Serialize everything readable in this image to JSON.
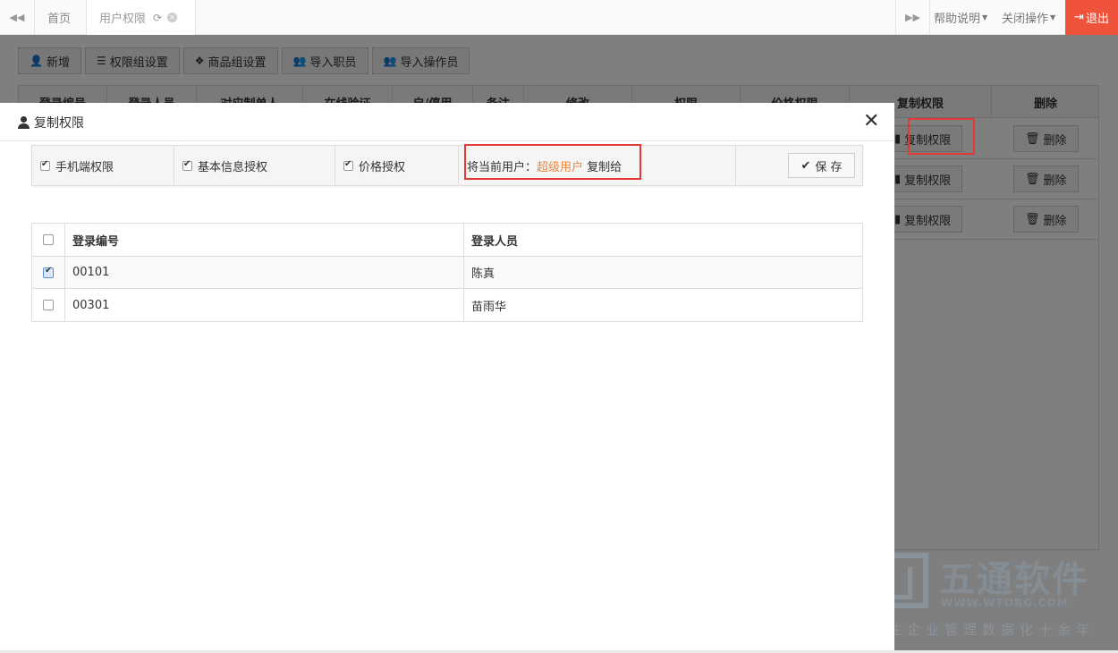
{
  "topbar": {
    "tabs": [
      {
        "label": "首页"
      },
      {
        "label": "用户权限"
      }
    ],
    "right_menu": {
      "help": "帮助说明",
      "close_ops": "关闭操作",
      "logout": "退出"
    }
  },
  "toolbar": {
    "buttons": [
      {
        "label": "新增",
        "icon": "user-plus-icon"
      },
      {
        "label": "权限组设置",
        "icon": "list-icon"
      },
      {
        "label": "商品组设置",
        "icon": "cubes-icon"
      },
      {
        "label": "导入职员",
        "icon": "users-icon"
      },
      {
        "label": "导入操作员",
        "icon": "users-icon"
      }
    ]
  },
  "bg_table": {
    "headers": [
      "登录编号",
      "登录人员",
      "对应制单人",
      "在线验证",
      "启/停用",
      "备注",
      "修改",
      "权限",
      "价格权限",
      "复制权限",
      "删除"
    ],
    "row_actions": {
      "copy": "复制权限",
      "delete": "删除"
    }
  },
  "watermark": {
    "title": "五通软件",
    "url": "WWW.WTORG.COM",
    "subtitle": "专注企业管理数据化十余年"
  },
  "modal": {
    "title": "复制权限",
    "options": {
      "mobile": "手机端权限",
      "basic": "基本信息授权",
      "price": "价格授权"
    },
    "copy_prefix": "将当前用户：",
    "copy_user": "超级用户",
    "copy_suffix": " 复制给",
    "save_label": "保 存",
    "table": {
      "headers": [
        "登录编号",
        "登录人员"
      ],
      "rows": [
        {
          "code": "00101",
          "name": "陈真",
          "checked": true
        },
        {
          "code": "00301",
          "name": "苗雨华",
          "checked": false
        }
      ]
    }
  },
  "colors": {
    "accent_logout": "#f0533c",
    "highlight_user": "#f0843c",
    "annotation_box": "#e53935"
  }
}
